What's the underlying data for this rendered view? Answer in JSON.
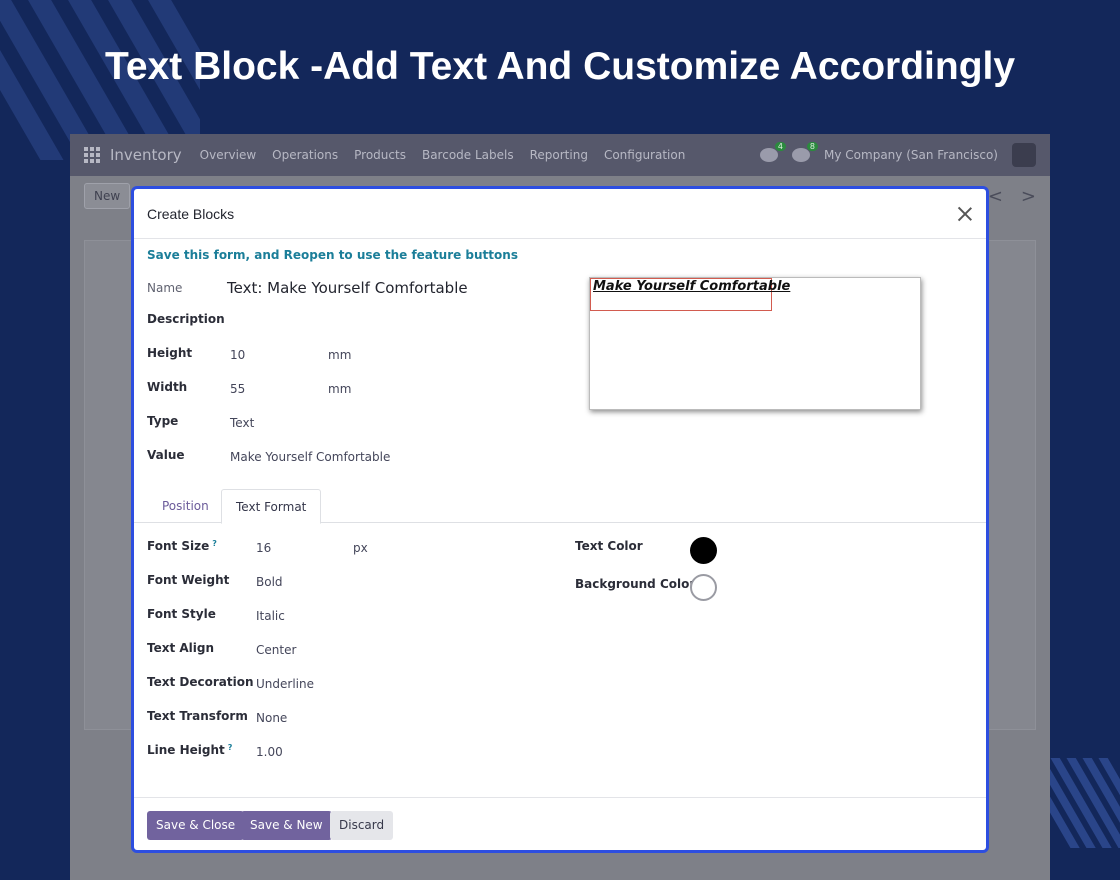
{
  "headline": "Text Block -Add Text And Customize Accordingly",
  "app": {
    "brand": "Inventory",
    "menu": [
      "Overview",
      "Operations",
      "Products",
      "Barcode Labels",
      "Reporting",
      "Configuration"
    ],
    "messages_count": "4",
    "activities_count": "8",
    "company": "My Company (San Francisco)",
    "new_label": "New",
    "pager_prev": "<",
    "pager_next": ">"
  },
  "dialog": {
    "title": "Create Blocks",
    "notice": "Save this form, and Reopen to use the feature buttons",
    "fields": {
      "name_label": "Name",
      "name_value": "Text: Make Yourself Comfortable",
      "description_label": "Description",
      "height_label": "Height",
      "height_value": "10",
      "height_unit": "mm",
      "width_label": "Width",
      "width_value": "55",
      "width_unit": "mm",
      "type_label": "Type",
      "type_value": "Text",
      "value_label": "Value",
      "value_value": "Make Yourself Comfortable"
    },
    "preview_text": "Make Yourself Comfortable",
    "tabs": [
      "Position",
      "Text Format"
    ],
    "format": {
      "font_size_label": "Font Size",
      "font_size_help": "?",
      "font_size_value": "16",
      "font_size_unit": "px",
      "font_weight_label": "Font Weight",
      "font_weight_value": "Bold",
      "font_style_label": "Font Style",
      "font_style_value": "Italic",
      "text_align_label": "Text Align",
      "text_align_value": "Center",
      "text_decoration_label": "Text Decoration",
      "text_decoration_value": "Underline",
      "text_transform_label": "Text Transform",
      "text_transform_value": "None",
      "line_height_label": "Line Height",
      "line_height_help": "?",
      "line_height_value": "1.00",
      "text_color_label": "Text Color",
      "text_color": "#000000",
      "background_color_label": "Background Color",
      "background_color": "#ffffff"
    },
    "buttons": {
      "save_close": "Save & Close",
      "save_new": "Save & New",
      "discard": "Discard"
    }
  }
}
